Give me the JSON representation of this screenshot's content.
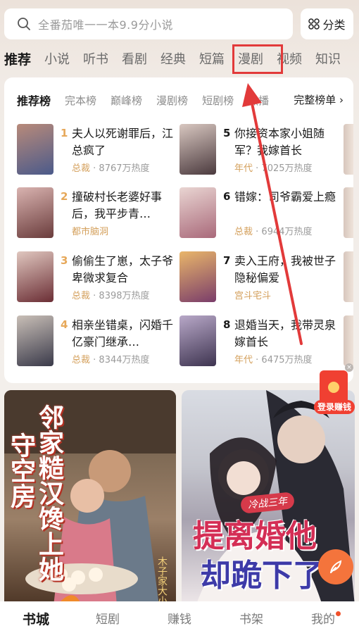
{
  "search": {
    "placeholder": "全番茄唯一一本9.9分小说"
  },
  "category_button": "分类",
  "tabs": [
    "推荐",
    "小说",
    "听书",
    "看剧",
    "经典",
    "短篇",
    "漫剧",
    "视频",
    "知识"
  ],
  "active_tab": "推荐",
  "highlighted_tab": "漫剧",
  "ranking": {
    "tabs": [
      "推荐榜",
      "完本榜",
      "巅峰榜",
      "漫剧榜",
      "短剧榜",
      "热播"
    ],
    "more_label": "完整榜单 ›",
    "books": [
      {
        "rank": "1",
        "title": "夫人以死谢罪后，江总疯了",
        "genre": "总裁",
        "heat": "8767万热度",
        "cover_colors": [
          "#b88a7a",
          "#4b5a8a"
        ]
      },
      {
        "rank": "2",
        "title": "撞破村长老婆好事后，我平步青…",
        "genre": "都市脑洞",
        "heat": "",
        "cover_colors": [
          "#d9b3b0",
          "#6a3c3c"
        ]
      },
      {
        "rank": "3",
        "title": "偷偷生了崽，太子爷卑微求复合",
        "genre": "总裁",
        "heat": "8398万热度",
        "cover_colors": [
          "#e0c7bf",
          "#6b2e35"
        ]
      },
      {
        "rank": "4",
        "title": "相亲坐错桌，闪婚千亿豪门继承…",
        "genre": "总裁",
        "heat": "8344万热度",
        "cover_colors": [
          "#c9bfb7",
          "#3a3a4a"
        ]
      },
      {
        "rank": "5",
        "title": "你接资本家小姐随军？我嫁首长",
        "genre": "年代",
        "heat": "7025万热度",
        "cover_colors": [
          "#d8c7c0",
          "#4b3a3e"
        ]
      },
      {
        "rank": "6",
        "title": "错嫁：司爷霸爱上瘾",
        "genre": "总裁",
        "heat": "6944万热度",
        "cover_colors": [
          "#e9d5d2",
          "#a9697a"
        ]
      },
      {
        "rank": "7",
        "title": "卖入王府，我被世子隐秘偏爱",
        "genre": "宫斗宅斗",
        "heat": "",
        "cover_colors": [
          "#e9b66a",
          "#7a3d6a"
        ]
      },
      {
        "rank": "8",
        "title": "退婚当天，我带灵泉嫁首长",
        "genre": "年代",
        "heat": "6475万热度",
        "cover_colors": [
          "#b8a8c8",
          "#3e3450"
        ]
      }
    ]
  },
  "feed": {
    "left": {
      "title": "邻家糙汉馋上她",
      "title_line2": "守空房",
      "author": "木子家大小"
    },
    "right": {
      "subtitle": "冷战三年",
      "title_line1": "提离婚他",
      "title_line2": "却跪下了"
    }
  },
  "bonus_label": "登录赚钱",
  "bottom_nav": [
    "书城",
    "短剧",
    "赚钱",
    "书架",
    "我的"
  ],
  "colors": {
    "highlight": "#e23a3a",
    "accent_gold": "#e6a85a",
    "genre": "#d4a05c"
  }
}
